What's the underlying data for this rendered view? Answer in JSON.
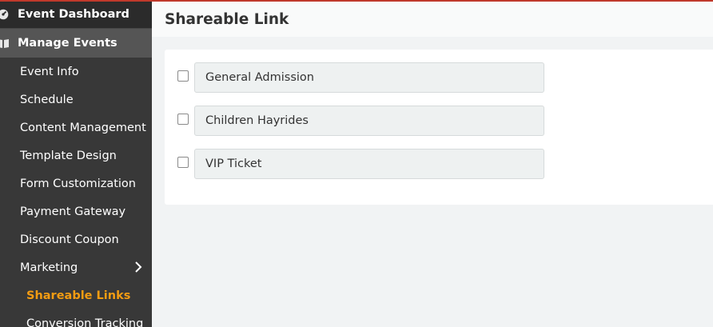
{
  "sidebar": {
    "groups": [
      {
        "label": "Event Dashboard",
        "icon": "dashboard-icon"
      },
      {
        "label": "Manage Events",
        "icon": "book-icon"
      }
    ],
    "items": [
      {
        "label": "Event Info"
      },
      {
        "label": "Schedule"
      },
      {
        "label": "Content Management"
      },
      {
        "label": "Template Design"
      },
      {
        "label": "Form Customization"
      },
      {
        "label": "Payment Gateway"
      },
      {
        "label": "Discount Coupon"
      },
      {
        "label": "Marketing",
        "icon": "chevron-right-icon"
      }
    ],
    "subitems": [
      {
        "label": "Shareable Links",
        "active": true
      },
      {
        "label": "Conversion Tracking"
      }
    ]
  },
  "header": {
    "title": "Shareable Link"
  },
  "tickets": [
    {
      "label": "General Admission",
      "checked": false
    },
    {
      "label": "Children Hayrides",
      "checked": false
    },
    {
      "label": "VIP Ticket",
      "checked": false
    }
  ],
  "colors": {
    "accent": "#f39c12",
    "sidebar": "#383838",
    "top_border": "#c0392b"
  }
}
